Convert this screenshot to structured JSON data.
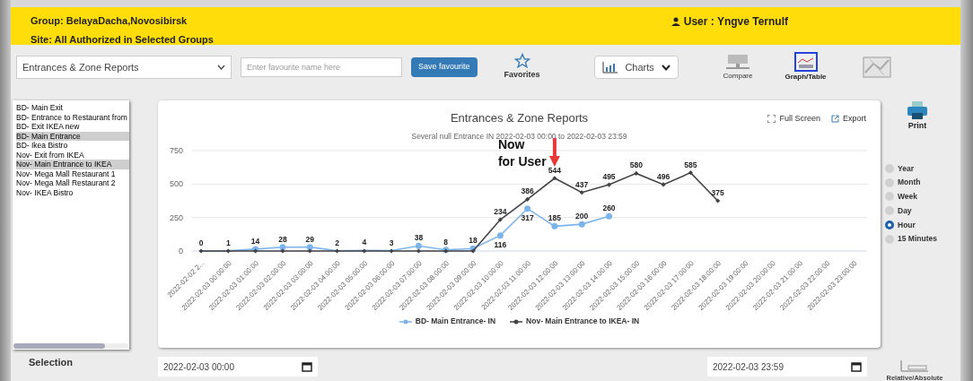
{
  "header": {
    "group": "Group:  BelayaDacha,Novosibirsk",
    "site": "Site:  All Authorized in Selected Groups",
    "user": "User : Yngve Ternulf"
  },
  "toolbar": {
    "report_select": "Entrances & Zone Reports",
    "favourite_field": {
      "placeholder": "Enter favourite name here"
    },
    "save_button": "Save favourite",
    "favorites": "Favorites",
    "charts_dropdown": "Charts",
    "compare": "Compare",
    "graph_table": {
      "label": "Graph/Table",
      "selected": true
    }
  },
  "zones": [
    {
      "label": "BD- Main Exit",
      "selected": false
    },
    {
      "label": "BD- Entrance to Restaurant from",
      "selected": false
    },
    {
      "label": "BD- Exit IKEA new",
      "selected": false
    },
    {
      "label": "BD- Main Entrance",
      "selected": true
    },
    {
      "label": "BD- Ikea Bistro",
      "selected": false
    },
    {
      "label": "Nov- Exit from IKEA",
      "selected": false
    },
    {
      "label": "Nov- Main Entrance to IKEA",
      "selected": true
    },
    {
      "label": "Nov- Mega Mall Restaurant 1",
      "selected": false
    },
    {
      "label": "Nov- Mega Mall Restaurant 2",
      "selected": false
    },
    {
      "label": "Nov- IKEA Bistro",
      "selected": false
    }
  ],
  "selection_label": "Selection",
  "chart": {
    "full_screen": "Full Screen",
    "export": "Export",
    "chart_data": {
      "type": "line",
      "title": "Entrances & Zone Reports",
      "subtitle": "Several null Entrance IN 2022-02-03 00:00 to 2022-02-03 23:59",
      "categories": [
        "2022-02-02 2...",
        "2022-02-03 00:00:00",
        "2022-02-03 01:00:00",
        "2022-02-03 02:00:00",
        "2022-02-03 03:00:00",
        "2022-02-03 04:00:00",
        "2022-02-03 05:00:00",
        "2022-02-03 06:00:00",
        "2022-02-03 07:00:00",
        "2022-02-03 08:00:00",
        "2022-02-03 09:00:00",
        "2022-02-03 10:00:00",
        "2022-02-03 11:00:00",
        "2022-02-03 12:00:00",
        "2022-02-03 13:00:00",
        "2022-02-03 14:00:00",
        "2022-02-03 15:00:00",
        "2022-02-03 16:00:00",
        "2022-02-03 17:00:00",
        "2022-02-03 18:00:00",
        "2022-02-03 19:00:00",
        "2022-02-03 20:00:00",
        "2022-02-03 21:00:00",
        "2022-02-03 22:00:00",
        "2022-02-03 23:00:00"
      ],
      "series": [
        {
          "name": "BD- Main Entrance- IN",
          "color": "#7cb5ec",
          "marker": "circle",
          "values": [
            0,
            1,
            14,
            28,
            29,
            2,
            4,
            3,
            38,
            8,
            18,
            116,
            317,
            185,
            200,
            260,
            null,
            null,
            null,
            null,
            null,
            null,
            null,
            null,
            null
          ],
          "value_labels": [
            "0",
            "1",
            "14",
            "28",
            "29",
            "2",
            "4",
            "3",
            "38",
            "8",
            "18",
            "116",
            "317",
            "185",
            "200",
            "260",
            null,
            null,
            null,
            null,
            null,
            null,
            null,
            null,
            null
          ]
        },
        {
          "name": "Nov- Main Entrance to IKEA- IN",
          "color": "#434348",
          "marker": "diamond",
          "values": [
            0,
            0,
            0,
            0,
            0,
            0,
            0,
            0,
            0,
            0,
            0,
            234,
            386,
            544,
            437,
            495,
            580,
            496,
            585,
            375,
            null,
            null,
            null,
            null,
            null
          ],
          "value_labels": [
            null,
            null,
            null,
            null,
            null,
            null,
            null,
            null,
            null,
            null,
            null,
            "234",
            "386",
            "544",
            "437",
            "495",
            "580",
            "496",
            "585",
            "375",
            null,
            null,
            null,
            null,
            null
          ]
        }
      ],
      "ylim": [
        0,
        750
      ],
      "yticks": [
        0,
        250,
        500,
        750
      ],
      "data_labels": "value_labels",
      "annotations": [
        {
          "text": "Now\nfor User"
        }
      ]
    }
  },
  "print": "Print",
  "intervals": [
    {
      "label": "Year",
      "selected": false
    },
    {
      "label": "Month",
      "selected": false
    },
    {
      "label": "Week",
      "selected": false
    },
    {
      "label": "Day",
      "selected": false
    },
    {
      "label": "Hour",
      "selected": true
    },
    {
      "label": "15 Minutes",
      "selected": false
    }
  ],
  "date_from": "2022-02-03 00:00",
  "date_to": "2022-02-03 23:59",
  "relative_absolute": "Relative/Absolute"
}
